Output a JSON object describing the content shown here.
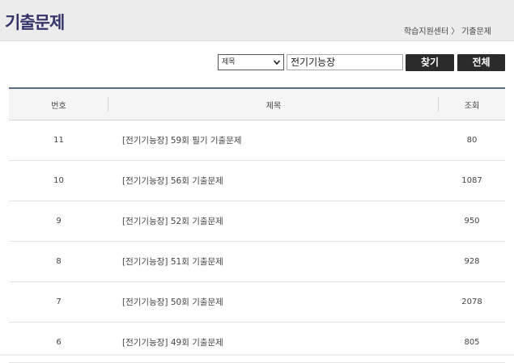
{
  "header": {
    "title": "기출문제"
  },
  "breadcrumb": {
    "parent": "학습지원센터",
    "separator": "〉",
    "current": "기출문제"
  },
  "search": {
    "field_select": "제목",
    "query": "전기기능장",
    "find_label": "찾기",
    "all_label": "전체"
  },
  "table": {
    "columns": [
      "번호",
      "제목",
      "조회"
    ],
    "rows": [
      {
        "num": "11",
        "title": "[전기기능장] 59회 필기 기출문제",
        "views": "80"
      },
      {
        "num": "10",
        "title": "[전기기능장] 56회 기출문제",
        "views": "1087"
      },
      {
        "num": "9",
        "title": "[전기기능장] 52회 기출문제",
        "views": "950"
      },
      {
        "num": "8",
        "title": "[전기기능장] 51회 기출문제",
        "views": "928"
      },
      {
        "num": "7",
        "title": "[전기기능장] 50회 기출문제",
        "views": "2078"
      },
      {
        "num": "6",
        "title": "[전기기능장] 49회 기출문제",
        "views": "805"
      }
    ]
  }
}
